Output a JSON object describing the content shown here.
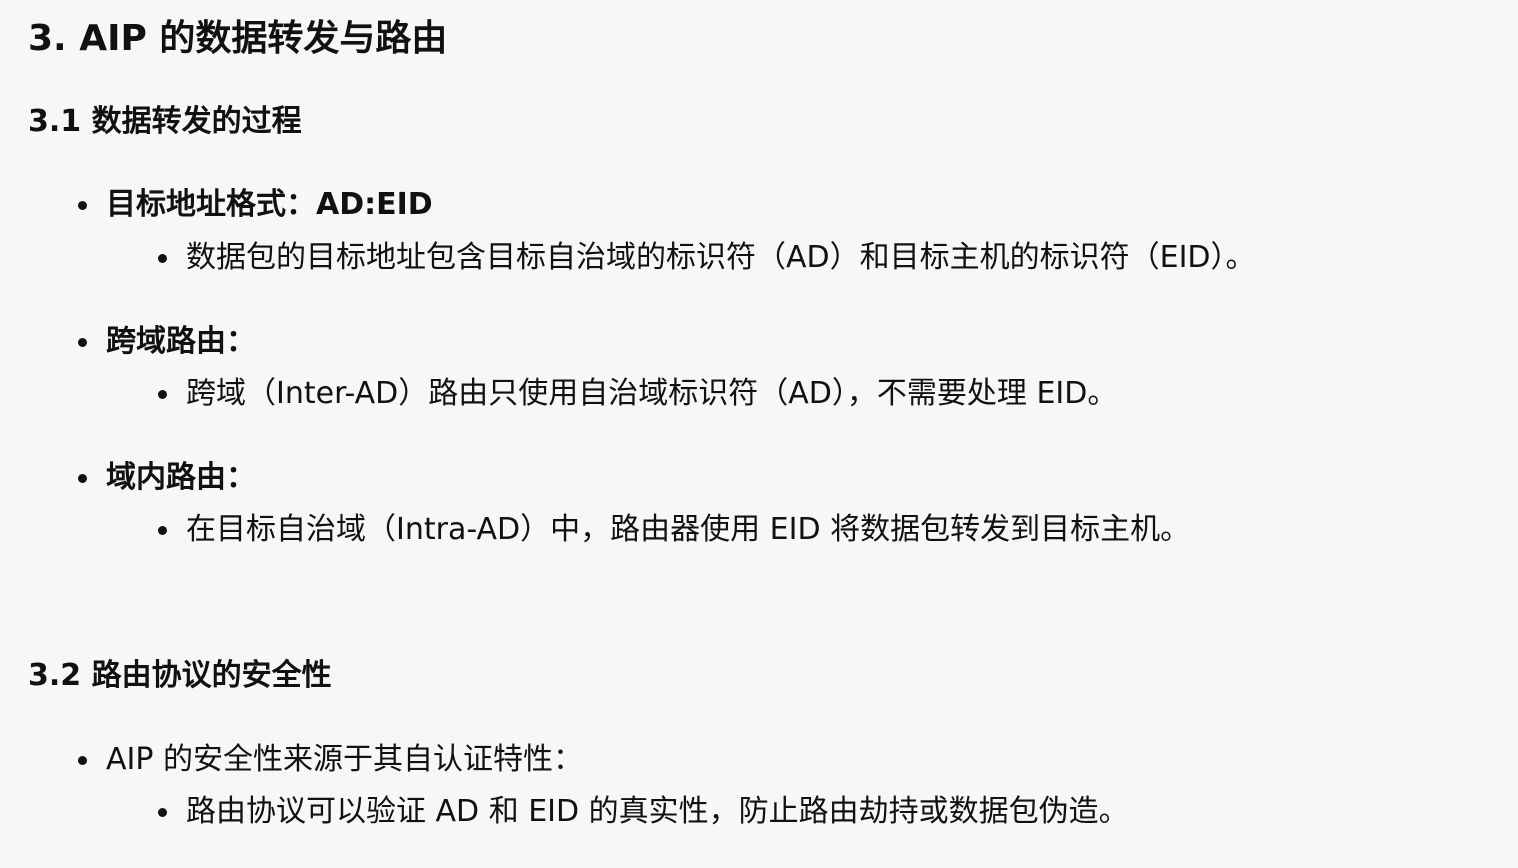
{
  "section3": {
    "title": "3. AIP 的数据转发与路由"
  },
  "section3_1": {
    "title": "3.1 数据转发的过程",
    "items": [
      {
        "label": "目标地址格式：AD:EID",
        "sub": "数据包的目标地址包含目标自治域的标识符（AD）和目标主机的标识符（EID）。"
      },
      {
        "label": "跨域路由：",
        "sub": "跨域（Inter-AD）路由只使用自治域标识符（AD），不需要处理 EID。"
      },
      {
        "label": "域内路由：",
        "sub": "在目标自治域（Intra-AD）中，路由器使用 EID 将数据包转发到目标主机。"
      }
    ]
  },
  "section3_2": {
    "title": "3.2 路由协议的安全性",
    "items": [
      {
        "label": "AIP 的安全性来源于其自认证特性：",
        "sub": "路由协议可以验证 AD 和 EID 的真实性，防止路由劫持或数据包伪造。"
      }
    ]
  }
}
